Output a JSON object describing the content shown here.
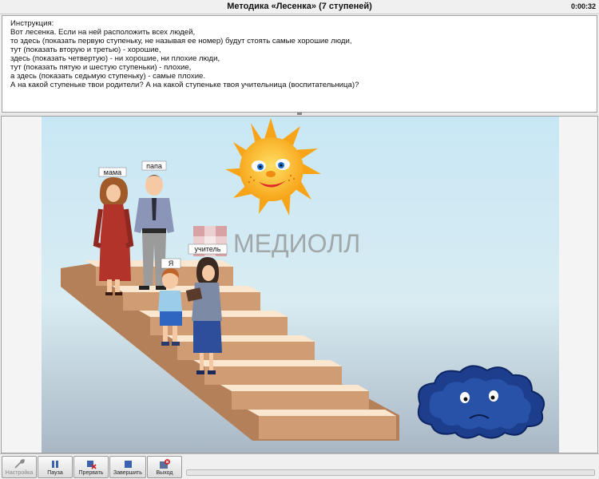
{
  "window": {
    "title": "Методика «Лесенка» (7 ступеней)",
    "timer": "0:00:32"
  },
  "instructions": {
    "lines": [
      "Инструкция:",
      "Вот лесенка. Если на ней расположить всех людей,",
      "то здесь (показать первую ступеньку, не называя ее номер) будут стоять самые хорошие люди,",
      "тут (показать вторую и третью) - хорошие,",
      "здесь (показать четвертую) - ни хорошие, ни плохие люди,",
      "тут (показать пятую и шестую ступеньки) - плохие,",
      "а здесь (показать седьмую ступеньку) - самые плохие.",
      "А на какой ступеньке твои родители? А на какой ступеньке твоя учительница (воспитательница)?"
    ]
  },
  "scene": {
    "labels": {
      "mom": "мама",
      "dad": "папа",
      "me": "Я",
      "teacher": "учитель"
    },
    "watermark": "МЕДИОЛЛ",
    "colors": {
      "sky_top": "#c7e6f4",
      "sky_bottom": "#a6b6c6",
      "step_top": "#fbe7d2",
      "step_front": "#cc9a72",
      "stair_side": "#b07d57",
      "sun": "#f8a819",
      "cloud": "#1d3e8c",
      "watermark_red": "#e04a43",
      "watermark_gray": "#8c8c8c"
    }
  },
  "toolbar": {
    "settings": "Настройка",
    "pause": "Пауза",
    "interrupt": "Прервать",
    "finish": "Завершить",
    "exit": "Выход"
  },
  "progress": {
    "value": 0
  }
}
